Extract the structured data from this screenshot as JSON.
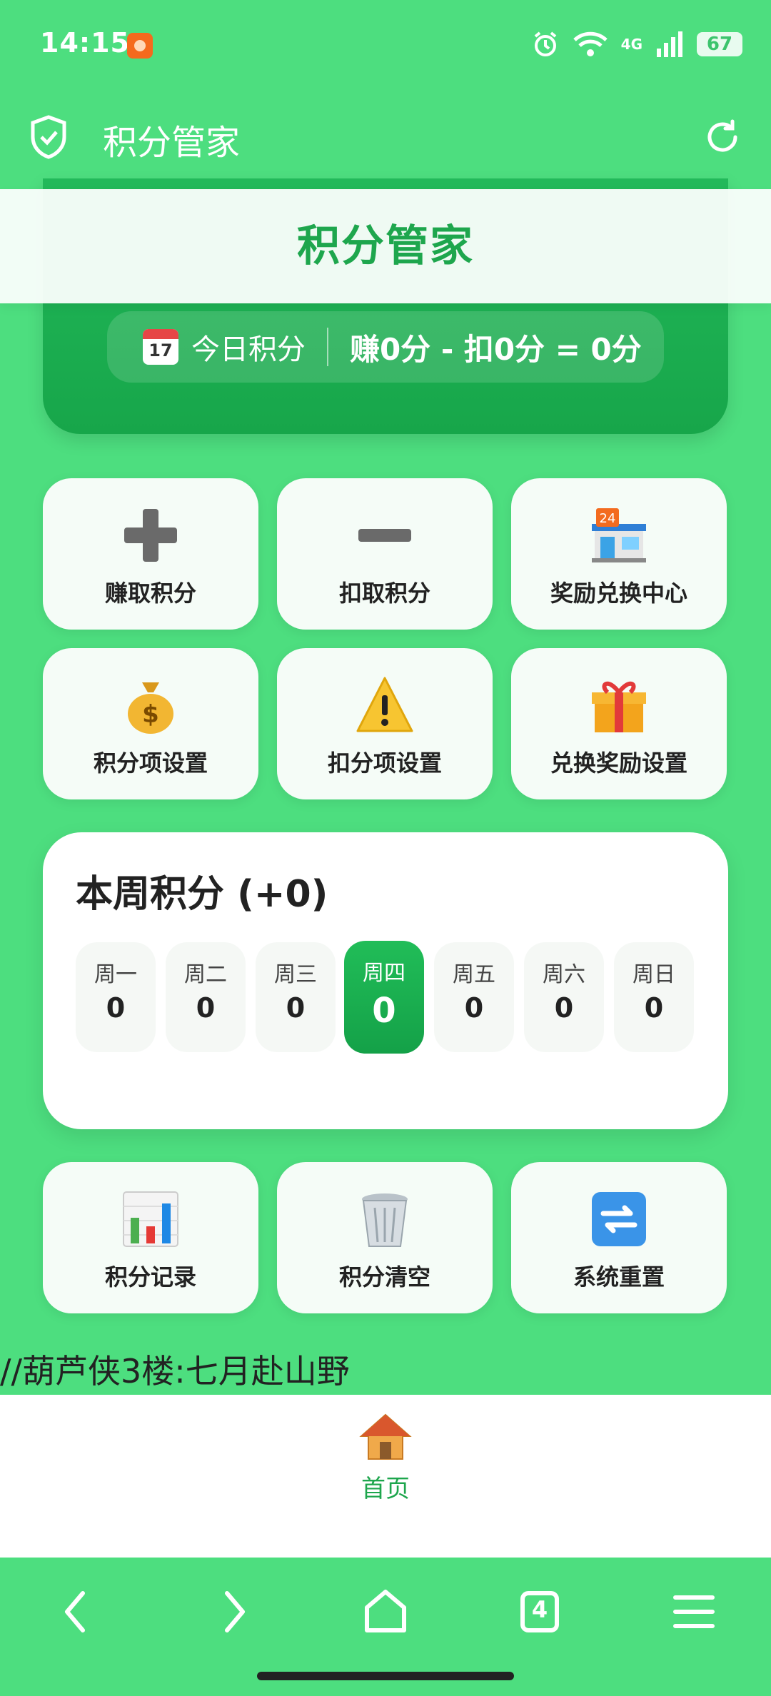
{
  "status_bar": {
    "time": "14:15",
    "network": "4G",
    "battery": "67"
  },
  "header": {
    "title": "积分管家"
  },
  "hero": {
    "banner_title": "积分管家",
    "today_label": "今日积分",
    "today_value": "赚0分 - 扣0分 = 0分"
  },
  "actions": [
    {
      "label": "赚取积分",
      "icon": "plus-icon"
    },
    {
      "label": "扣取积分",
      "icon": "minus-icon"
    },
    {
      "label": "奖励兑换中心",
      "icon": "store-icon"
    },
    {
      "label": "积分项设置",
      "icon": "money-bag-icon"
    },
    {
      "label": "扣分项设置",
      "icon": "warning-icon"
    },
    {
      "label": "兑换奖励设置",
      "icon": "gift-icon"
    }
  ],
  "week": {
    "title": "本周积分 (+0)",
    "days": [
      {
        "name": "周一",
        "value": "0"
      },
      {
        "name": "周二",
        "value": "0"
      },
      {
        "name": "周三",
        "value": "0"
      },
      {
        "name": "周四",
        "value": "0"
      },
      {
        "name": "周五",
        "value": "0"
      },
      {
        "name": "周六",
        "value": "0"
      },
      {
        "name": "周日",
        "value": "0"
      }
    ],
    "active_day": "周四"
  },
  "tools": [
    {
      "label": "积分记录",
      "icon": "chart-icon"
    },
    {
      "label": "积分清空",
      "icon": "trash-icon"
    },
    {
      "label": "系统重置",
      "icon": "reset-icon"
    }
  ],
  "footer_text": "//葫芦侠3楼:七月赴山野",
  "bottom_nav": {
    "home_label": "首页"
  },
  "system_nav": {
    "tabs_count": "4"
  },
  "colors": {
    "primary": "#4dde7f",
    "accent": "#1ea64d",
    "hero": "#17a64a"
  }
}
